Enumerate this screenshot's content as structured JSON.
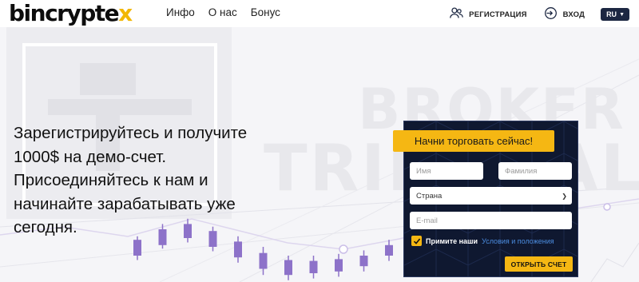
{
  "header": {
    "logo_main": "bincrypte",
    "logo_x": "x",
    "nav": [
      "Инфо",
      "О нас",
      "Бонус"
    ],
    "register_label": "РЕГИСТРАЦИЯ",
    "login_label": "ВХОД",
    "lang_label": "RU"
  },
  "hero": {
    "headline": "Зарегистрируйтесь и получите 1000$ на демо-счет. Присоединяйтесь к нам и начинайте зарабатывать уже сегодня.",
    "watermark_top": "BROKER",
    "watermark_bottom": "TRIBUNAL"
  },
  "form": {
    "banner": "Начни торговать сейчас!",
    "first_name_placeholder": "Имя",
    "last_name_placeholder": "Фамилия",
    "country_value": "Страна",
    "email_placeholder": "E-mail",
    "terms_prefix": "Примите наши",
    "terms_link": "Условия и положения",
    "terms_checked": true,
    "submit_label": "ОТКРЫТЬ СЧЕТ"
  },
  "colors": {
    "accent": "#f5b713",
    "panel": "#0f1830",
    "lang_bg": "#1c2742",
    "candles": "#8d72c9"
  },
  "candles": [
    {
      "open": 0.3,
      "close": 0.48,
      "high": 0.52,
      "low": 0.25
    },
    {
      "open": 0.42,
      "close": 0.6,
      "high": 0.66,
      "low": 0.38
    },
    {
      "open": 0.5,
      "close": 0.66,
      "high": 0.72,
      "low": 0.45
    },
    {
      "open": 0.4,
      "close": 0.58,
      "high": 0.63,
      "low": 0.35
    },
    {
      "open": 0.28,
      "close": 0.46,
      "high": 0.52,
      "low": 0.22
    },
    {
      "open": 0.15,
      "close": 0.33,
      "high": 0.4,
      "low": 0.08
    },
    {
      "open": 0.08,
      "close": 0.25,
      "high": 0.3,
      "low": 0.02
    },
    {
      "open": 0.1,
      "close": 0.24,
      "high": 0.3,
      "low": 0.04
    },
    {
      "open": 0.12,
      "close": 0.26,
      "high": 0.32,
      "low": 0.06
    },
    {
      "open": 0.18,
      "close": 0.3,
      "high": 0.36,
      "low": 0.12
    },
    {
      "open": 0.3,
      "close": 0.42,
      "high": 0.48,
      "low": 0.24
    }
  ]
}
